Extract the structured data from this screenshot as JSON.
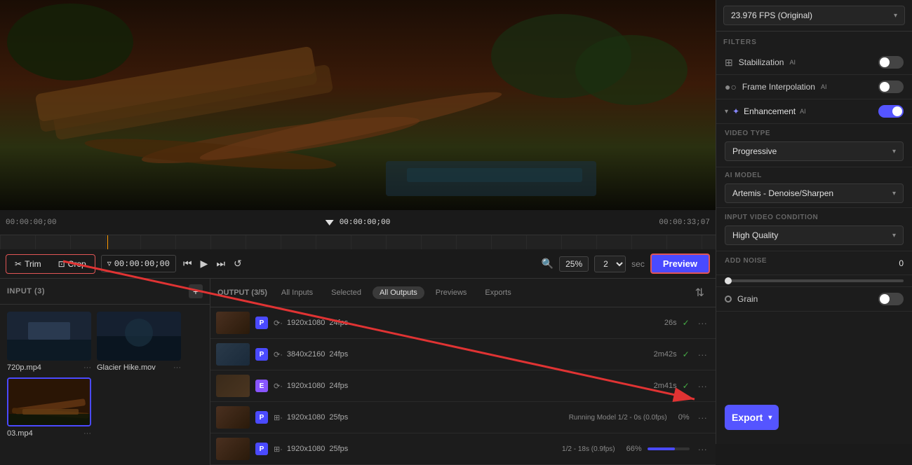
{
  "header": {
    "fps_label": "23.976 FPS (Original)"
  },
  "filters": {
    "section_title": "FILTERS",
    "stabilization": {
      "label": "Stabilization",
      "ai": "AI",
      "enabled": false
    },
    "frame_interpolation": {
      "label": "Frame Interpolation",
      "ai": "AI",
      "enabled": false
    },
    "enhancement": {
      "label": "Enhancement",
      "ai": "AI",
      "enabled": true
    }
  },
  "video_type": {
    "section_label": "VIDEO TYPE",
    "value": "Progressive"
  },
  "ai_model": {
    "section_label": "AI MODEL",
    "value": "Artemis - Denoise/Sharpen"
  },
  "input_video_condition": {
    "section_label": "INPUT VIDEO CONDITION",
    "value": "High Quality"
  },
  "add_noise": {
    "label": "ADD NOISE",
    "value": "0"
  },
  "grain": {
    "label": "Grain",
    "enabled": false
  },
  "export": {
    "label": "Export"
  },
  "toolbar": {
    "trim_label": "Trim",
    "crop_label": "Crop",
    "timecode": "00:00:00;00",
    "zoom_level": "25%",
    "multiplier": "2",
    "sec_label": "sec",
    "preview_label": "Preview"
  },
  "timeline": {
    "start_time": "00:00:00;00",
    "end_time": "00:00:33;07",
    "playhead_time": "00:00:00;00"
  },
  "input_panel": {
    "header": "INPUT (3)",
    "files": [
      {
        "name": "720p.mp4",
        "type": "720p"
      },
      {
        "name": "Glacier Hike.mov",
        "type": "glacier"
      },
      {
        "name": "03.mp4",
        "type": "bridge"
      }
    ]
  },
  "output_panel": {
    "header": "OUTPUT (3/5)",
    "tabs": [
      {
        "label": "All Inputs",
        "active": false
      },
      {
        "label": "Selected",
        "active": false
      },
      {
        "label": "All Outputs",
        "active": true
      },
      {
        "label": "Previews",
        "active": false
      },
      {
        "label": "Exports",
        "active": false
      }
    ],
    "rows": [
      {
        "badge": "P",
        "badge_type": "p",
        "resolution": "1920x1080",
        "fps": "24fps",
        "duration": "26s",
        "status": "done"
      },
      {
        "badge": "P",
        "badge_type": "p",
        "resolution": "3840x2160",
        "fps": "24fps",
        "duration": "2m42s",
        "status": "done"
      },
      {
        "badge": "E",
        "badge_type": "e",
        "resolution": "1920x1080",
        "fps": "24fps",
        "duration": "2m41s",
        "status": "done"
      },
      {
        "badge": "P",
        "badge_type": "p",
        "resolution": "1920x1080",
        "fps": "25fps",
        "running_text": "Running Model  1/2 - 0s (0.0fps)",
        "percent": "0%",
        "status": "running"
      },
      {
        "badge": "P",
        "badge_type": "p",
        "resolution": "1920x1080",
        "fps": "25fps",
        "running_text": "1/2 - 18s (0.9fps)",
        "percent": "66%",
        "progress": 66,
        "status": "running2"
      }
    ]
  }
}
